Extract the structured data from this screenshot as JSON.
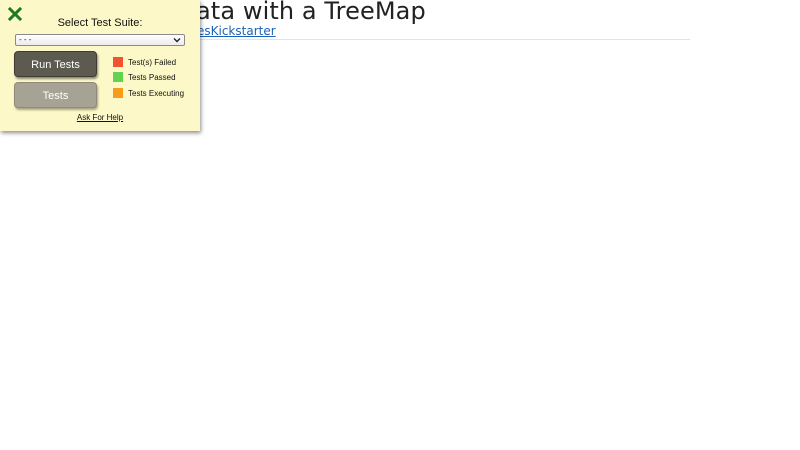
{
  "page": {
    "heading": "ata with a TreeMap",
    "link_text": "esKickstarter"
  },
  "panel": {
    "title": "Select Test Suite:",
    "suite_select": {
      "selected": "- - -"
    },
    "run_button_label": "Run Tests",
    "tests_button_label": "Tests",
    "help_link": "Ask For Help",
    "close_icon": "close-x-icon",
    "legend": [
      {
        "label": "Test(s) Failed",
        "color": "#f4512f"
      },
      {
        "label": "Tests Passed",
        "color": "#62d34f"
      },
      {
        "label": "Tests Executing",
        "color": "#f89a1c"
      }
    ]
  },
  "colors": {
    "panel_background": "#fdf8c8",
    "close_icon": "#1f7a1f",
    "run_button": "#5d5a4f",
    "tests_button": "#a6a394",
    "link": "#1a63b8"
  }
}
